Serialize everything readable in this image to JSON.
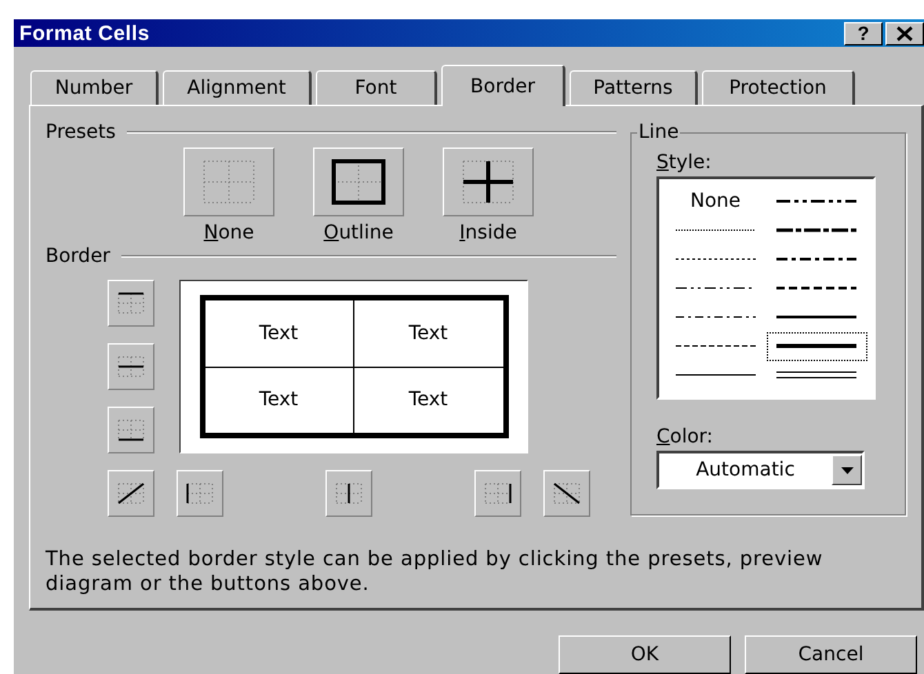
{
  "window": {
    "title": "Format Cells",
    "help_button": "?"
  },
  "tabs": [
    {
      "label": "Number",
      "selected": false
    },
    {
      "label": "Alignment",
      "selected": false
    },
    {
      "label": "Font",
      "selected": false
    },
    {
      "label": "Border",
      "selected": true
    },
    {
      "label": "Patterns",
      "selected": false
    },
    {
      "label": "Protection",
      "selected": false
    }
  ],
  "presets": {
    "label": "Presets",
    "items": [
      {
        "kind": "none",
        "label": "None"
      },
      {
        "kind": "outline",
        "label": "Outline"
      },
      {
        "kind": "inside",
        "label": "Inside"
      }
    ]
  },
  "border": {
    "label": "Border",
    "side_buttons": [
      {
        "kind": "top"
      },
      {
        "kind": "middle"
      },
      {
        "kind": "bottom"
      }
    ],
    "bottom_buttons": [
      {
        "kind": "diagonal-up"
      },
      {
        "kind": "left"
      },
      {
        "kind": "center"
      },
      {
        "kind": "right"
      },
      {
        "kind": "diagonal-down"
      }
    ],
    "preview": {
      "cells": [
        "Text",
        "Text",
        "Text",
        "Text"
      ]
    }
  },
  "line": {
    "label": "Line",
    "style_label": "Style:",
    "styles": [
      {
        "kind": "none",
        "label": "None",
        "selected": false
      },
      {
        "kind": "hair",
        "selected": false
      },
      {
        "kind": "dotted",
        "selected": false
      },
      {
        "kind": "dashdotdot",
        "selected": false
      },
      {
        "kind": "dashdot",
        "selected": false
      },
      {
        "kind": "dashed",
        "selected": false
      },
      {
        "kind": "thin",
        "selected": false
      },
      {
        "kind": "mediumdashdotdot",
        "selected": false
      },
      {
        "kind": "slantdashdot",
        "selected": false
      },
      {
        "kind": "mediumdashdot",
        "selected": false
      },
      {
        "kind": "mediumdashed",
        "selected": false
      },
      {
        "kind": "medium",
        "selected": false
      },
      {
        "kind": "thick",
        "selected": true
      },
      {
        "kind": "double",
        "selected": false
      }
    ],
    "color_label": "Color:",
    "color_value": "Automatic"
  },
  "description": "The selected border style can be applied by clicking the presets, preview diagram or the buttons above.",
  "buttons": [
    {
      "label": "OK"
    },
    {
      "label": "Cancel"
    }
  ]
}
